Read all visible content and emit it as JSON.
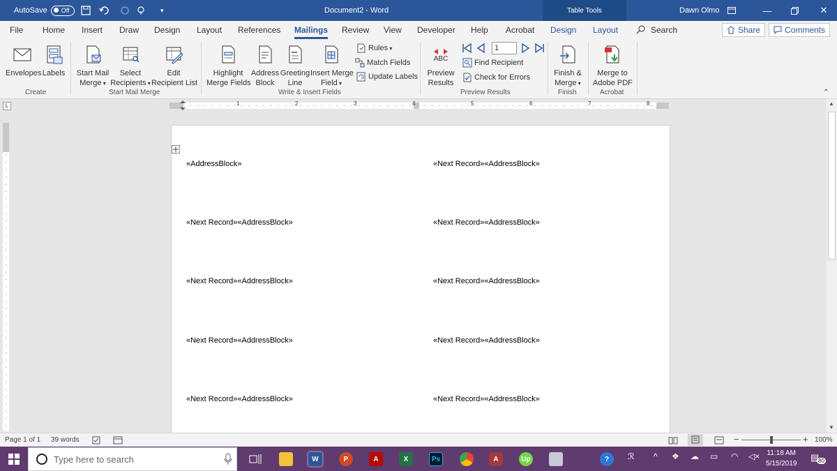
{
  "titlebar": {
    "autosave_label": "AutoSave",
    "autosave_state": "Off",
    "doc_title": "Document2  -  Word",
    "context_tab": "Table Tools",
    "user": "Dawn Olmo",
    "bg_color": "#2b579a"
  },
  "tabs": [
    "File",
    "Home",
    "Insert",
    "Draw",
    "Design",
    "Layout",
    "References",
    "Mailings",
    "Review",
    "View",
    "Developer",
    "Help",
    "Acrobat",
    "Design",
    "Layout"
  ],
  "active_tab": "Mailings",
  "search_placeholder": "Search",
  "share_label": "Share",
  "comments_label": "Comments",
  "ribbon": {
    "create": {
      "label": "Create",
      "envelopes": "Envelopes",
      "labels": "Labels"
    },
    "start": {
      "label": "Start Mail Merge",
      "start_l1": "Start Mail",
      "start_l2": "Merge",
      "select_l1": "Select",
      "select_l2": "Recipients",
      "edit_l1": "Edit",
      "edit_l2": "Recipient List"
    },
    "write": {
      "label": "Write & Insert Fields",
      "highlight_l1": "Highlight",
      "highlight_l2": "Merge Fields",
      "address_l1": "Address",
      "address_l2": "Block",
      "greeting_l1": "Greeting",
      "greeting_l2": "Line",
      "insert_l1": "Insert Merge",
      "insert_l2": "Field",
      "rules": "Rules",
      "match": "Match Fields",
      "update": "Update Labels"
    },
    "preview": {
      "label": "Preview Results",
      "preview_abc": "ABC",
      "preview_l1": "Preview",
      "preview_l2": "Results",
      "record_value": "1",
      "find": "Find Recipient",
      "check": "Check for Errors"
    },
    "finish": {
      "label": "Finish",
      "l1": "Finish &",
      "l2": "Merge"
    },
    "acrobat": {
      "label": "Acrobat",
      "l1": "Merge to",
      "l2": "Adobe PDF"
    }
  },
  "ruler_numbers": [
    "1",
    "2",
    "3",
    "4",
    "5",
    "6",
    "7",
    "8"
  ],
  "document": {
    "first_cell": "«AddressBlock»",
    "cells": [
      "«Next Record»«AddressBlock»",
      "«Next Record»«AddressBlock»",
      "«Next Record»«AddressBlock»",
      "«Next Record»«AddressBlock»",
      "«Next Record»«AddressBlock»",
      "«Next Record»«AddressBlock»",
      "«Next Record»«AddressBlock»",
      "«Next Record»«AddressBlock»",
      "«Next Record»«AddressBlock»"
    ]
  },
  "status": {
    "page": "Page 1 of 1",
    "words": "39 words",
    "zoom": "100%"
  },
  "taskbar": {
    "search_placeholder": "Type here to search",
    "time": "11:18 AM",
    "date": "5/15/2019",
    "notifications": "80"
  },
  "icons": [
    "windows-start-icon",
    "cortana-icon",
    "task-view-icon",
    "file-explorer-icon",
    "word-icon",
    "powerpoint-icon",
    "acrobat-icon",
    "excel-icon",
    "photoshop-icon",
    "chrome-icon",
    "access-icon",
    "upwork-icon",
    "snipping-icon"
  ]
}
